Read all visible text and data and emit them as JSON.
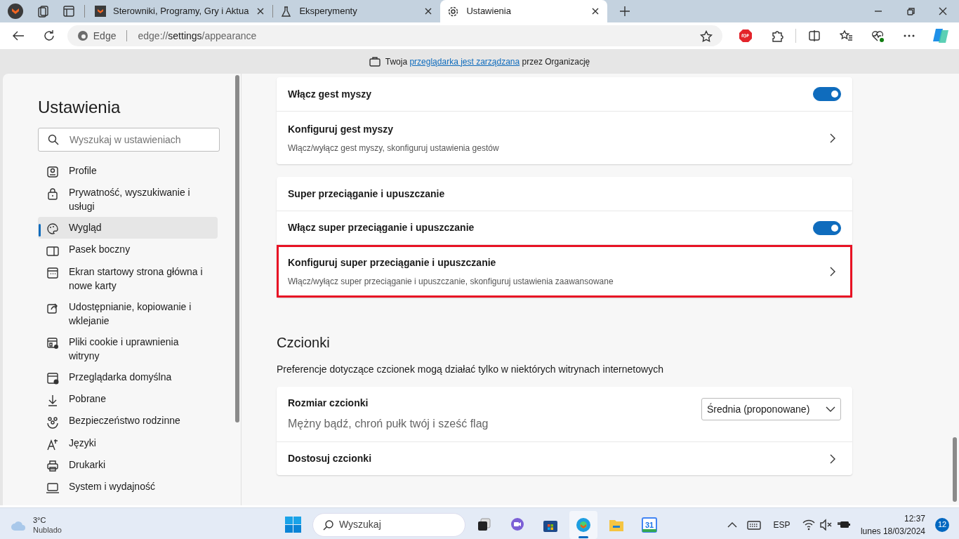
{
  "tabs": [
    {
      "title": "Sterowniki, Programy, Gry i Aktua",
      "selected": false
    },
    {
      "title": "Eksperymenty",
      "selected": false
    },
    {
      "title": "Ustawienia",
      "selected": true
    }
  ],
  "address_bar": {
    "site_label": "Edge",
    "url_scheme": "edge://",
    "url_host": "settings",
    "url_path": "/appearance"
  },
  "info_bar": {
    "text_before": "Twoja",
    "link": "przeglądarka jest zarządzana",
    "text_after": "przez Organizację"
  },
  "sidebar": {
    "title": "Ustawienia",
    "search": {
      "placeholder": "Wyszukaj w ustawieniach"
    },
    "items": [
      {
        "label": "Profile",
        "selected": false
      },
      {
        "label": "Prywatność, wyszukiwanie i usługi",
        "selected": false
      },
      {
        "label": "Wygląd",
        "selected": true
      },
      {
        "label": "Pasek boczny",
        "selected": false
      },
      {
        "label": "Ekran startowy strona główna i nowe karty",
        "selected": false
      },
      {
        "label": "Udostępnianie, kopiowanie i wklejanie",
        "selected": false
      },
      {
        "label": "Pliki cookie i uprawnienia witryny",
        "selected": false
      },
      {
        "label": "Przeglądarka domyślna",
        "selected": false
      },
      {
        "label": "Pobrane",
        "selected": false
      },
      {
        "label": "Bezpieczeństwo rodzinne",
        "selected": false
      },
      {
        "label": "Języki",
        "selected": false
      },
      {
        "label": "Drukarki",
        "selected": false
      },
      {
        "label": "System i wydajność",
        "selected": false
      }
    ]
  },
  "cards": [
    {
      "rows": [
        {
          "kind": "toggle",
          "title": "Włącz gest myszy",
          "on": true,
          "highlighted": false
        },
        {
          "kind": "link",
          "title": "Konfiguruj gest myszy",
          "description": "Włącz/wyłącz gest myszy, skonfiguruj ustawienia gestów",
          "highlighted": false
        }
      ]
    },
    {
      "rows": [
        {
          "kind": "header",
          "title": "Super przeciąganie i upuszczanie",
          "highlighted": false
        },
        {
          "kind": "toggle",
          "title": "Włącz super przeciąganie i upuszczanie",
          "on": true,
          "highlighted": false
        },
        {
          "kind": "link",
          "title": "Konfiguruj super przeciąganie i upuszczanie",
          "description": "Włącz/wyłącz super przeciąganie i upuszczanie, skonfiguruj ustawienia zaawansowane",
          "highlighted": true
        }
      ]
    }
  ],
  "fonts_section": {
    "heading": "Czcionki",
    "description": "Preferencje dotyczące czcionek mogą działać tylko w niektórych witrynach internetowych",
    "rows": [
      {
        "kind": "select",
        "title": "Rozmiar czcionki",
        "value": "Średnia (proponowane)",
        "sample": "Mężny bądź, chroń pułk twój i sześć flag",
        "highlighted": false
      },
      {
        "kind": "link",
        "title": "Dostosuj czcionki",
        "highlighted": false
      }
    ]
  },
  "taskbar": {
    "weather": {
      "temp": "3°C",
      "condition": "Nublado"
    },
    "search": {
      "placeholder": "Wyszukaj"
    },
    "apps": [
      {
        "selected": false
      },
      {
        "selected": false
      },
      {
        "selected": false
      },
      {
        "selected": true
      },
      {
        "selected": false
      },
      {
        "selected": false
      }
    ],
    "calendar_day": "31",
    "language": "ESP",
    "time": "12:37",
    "date": "lunes 18/03/2024",
    "notifications": "12"
  }
}
